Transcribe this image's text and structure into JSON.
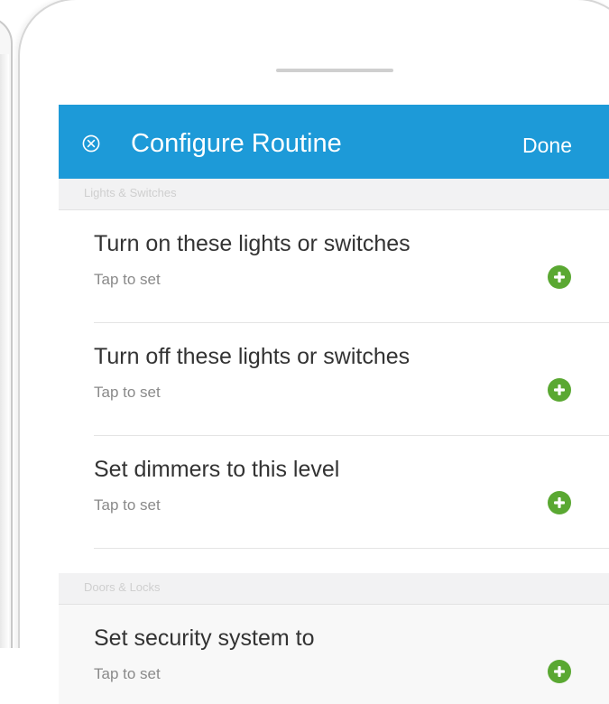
{
  "nav": {
    "close_icon": "close-circle-icon",
    "title": "Configure Routine",
    "done_label": "Done",
    "bar_color": "#1d9ad8"
  },
  "sections": [
    {
      "header": "Lights & Switches",
      "rows": [
        {
          "title": "Turn on these lights or switches",
          "subtitle": "Tap to set",
          "icon": "add-circle-icon"
        },
        {
          "title": "Turn off these lights or switches",
          "subtitle": "Tap to set",
          "icon": "add-circle-icon"
        },
        {
          "title": "Set dimmers to this level",
          "subtitle": "Tap to set",
          "icon": "add-circle-icon"
        }
      ]
    },
    {
      "header": "Doors & Locks",
      "rows": [
        {
          "title": "Set security system to",
          "subtitle": "Tap to set",
          "icon": "add-circle-icon"
        }
      ]
    }
  ],
  "colors": {
    "accent": "#1d9ad8",
    "add_button": "#5aa832"
  }
}
